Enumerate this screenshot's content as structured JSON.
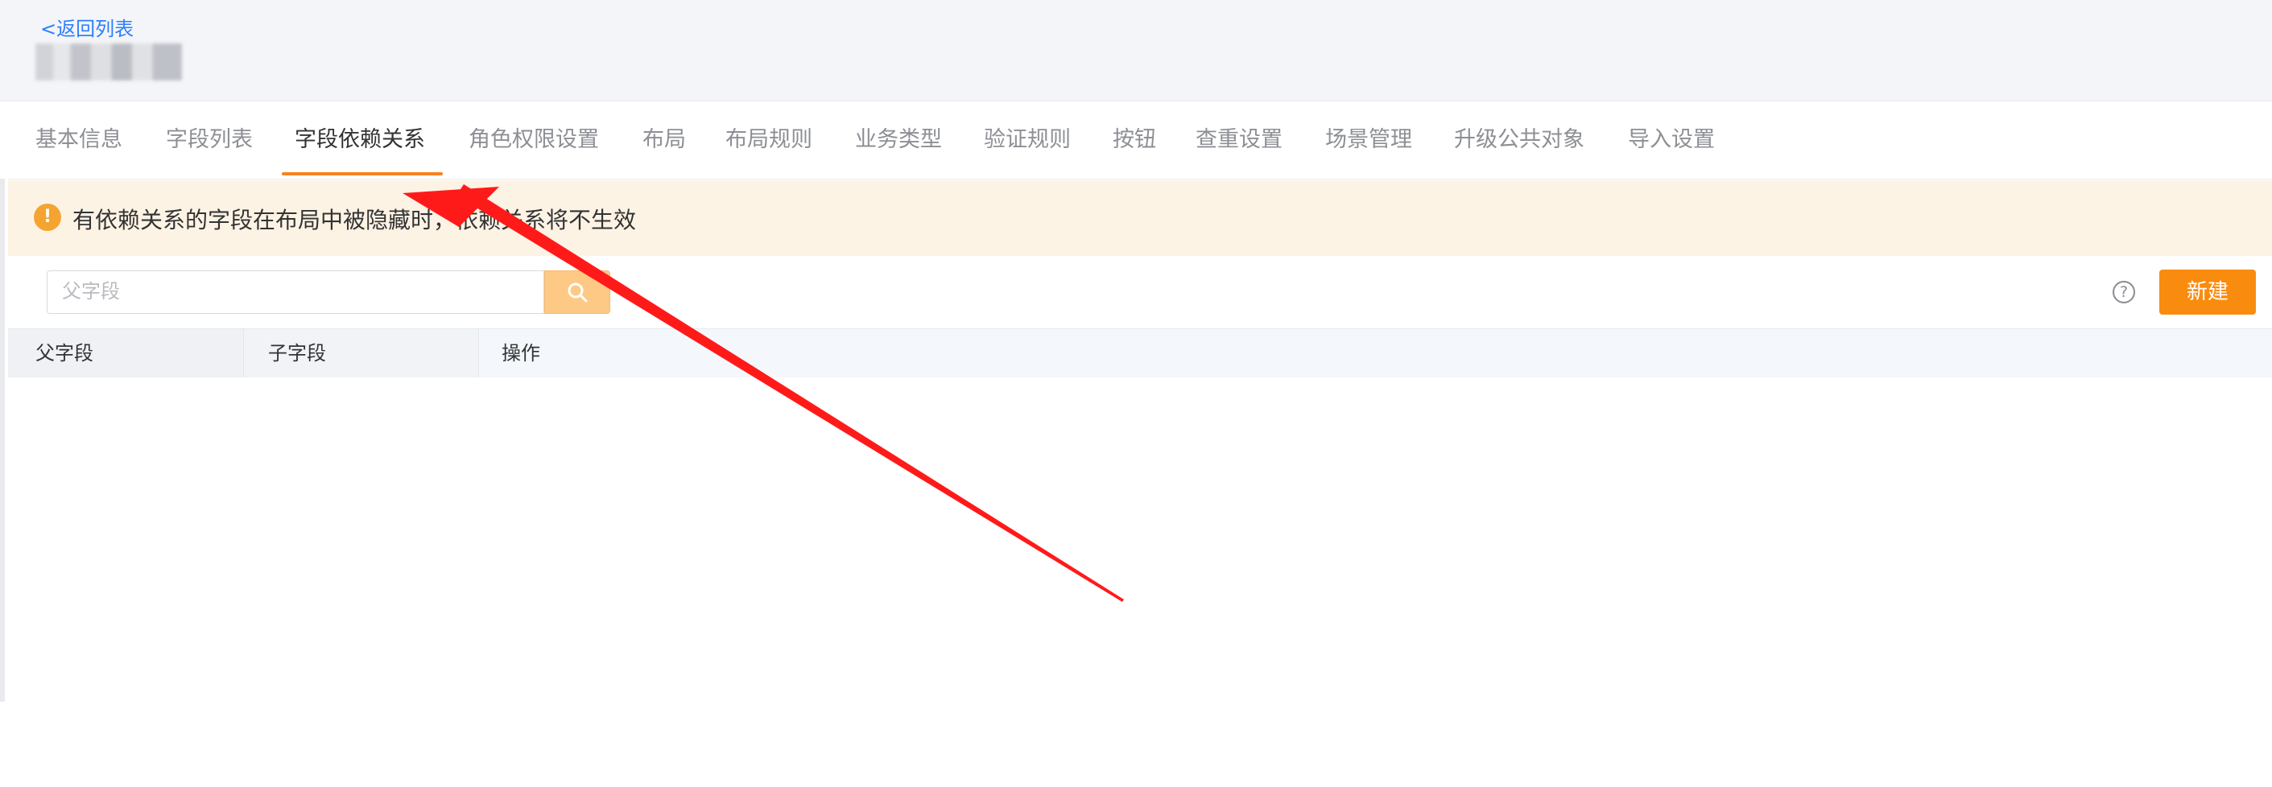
{
  "header": {
    "back_link": "<返回列表"
  },
  "tabs": [
    {
      "label": "基本信息",
      "active": false
    },
    {
      "label": "字段列表",
      "active": false
    },
    {
      "label": "字段依赖关系",
      "active": true
    },
    {
      "label": "角色权限设置",
      "active": false
    },
    {
      "label": "布局",
      "active": false
    },
    {
      "label": "布局规则",
      "active": false
    },
    {
      "label": "业务类型",
      "active": false
    },
    {
      "label": "验证规则",
      "active": false
    },
    {
      "label": "按钮",
      "active": false
    },
    {
      "label": "查重设置",
      "active": false
    },
    {
      "label": "场景管理",
      "active": false
    },
    {
      "label": "升级公共对象",
      "active": false
    },
    {
      "label": "导入设置",
      "active": false
    }
  ],
  "alert": {
    "icon": "warning-icon",
    "text": "有依赖关系的字段在布局中被隐藏时，依赖关系将不生效"
  },
  "search": {
    "placeholder": "父字段",
    "value": ""
  },
  "toolbar": {
    "help_icon": "help-icon",
    "help_glyph": "?",
    "new_label": "新建"
  },
  "table": {
    "columns": [
      "父字段",
      "子字段",
      "操作"
    ],
    "rows": []
  },
  "colors": {
    "accent": "#f98c0f",
    "link": "#2d7ff9",
    "alert_bg": "#fdf3e5",
    "annotation_arrow": "#ff0000"
  }
}
